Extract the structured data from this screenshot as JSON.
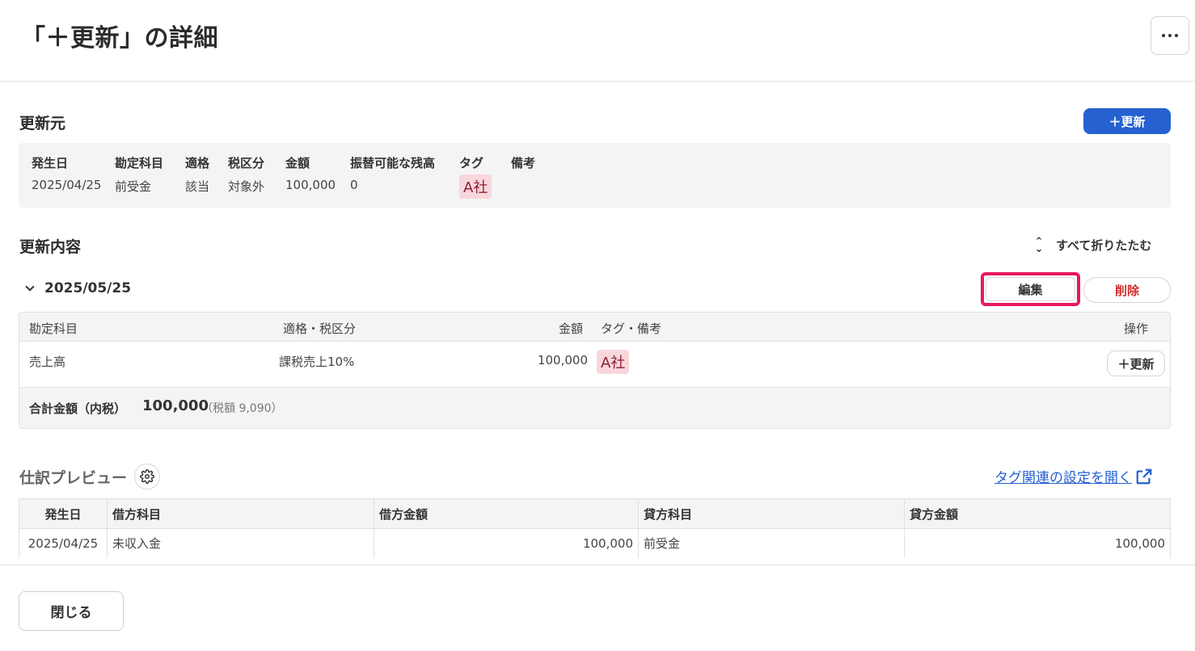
{
  "header": {
    "title": "「＋更新」の詳細",
    "more_icon": "more-horizontal-icon"
  },
  "source": {
    "section_title": "更新元",
    "add_button": "＋更新",
    "columns": [
      "発生日",
      "勘定科目",
      "適格",
      "税区分",
      "金額",
      "振替可能な残高",
      "タグ",
      "備考"
    ],
    "values": {
      "date": "2025/04/25",
      "account": "前受金",
      "qualified": "該当",
      "tax": "対象外",
      "amount": "100,000",
      "balance": "0",
      "tag": "A社",
      "memo": ""
    }
  },
  "update": {
    "section_title": "更新内容",
    "collapse_all": "すべて折りたたむ",
    "group_date": "2025/05/25",
    "edit_button": "編集",
    "delete_button": "削除",
    "table_headers": [
      "勘定科目",
      "適格・税区分",
      "金額",
      "タグ・備考",
      "操作"
    ],
    "row": {
      "account": "売上高",
      "tax": "課税売上10%",
      "amount": "100,000",
      "tag": "A社",
      "action": "＋更新"
    },
    "total_label": "合計金額（内税）",
    "total_amount": "100,000",
    "tax_note": "（税額 9,090）"
  },
  "preview": {
    "title": "仕訳プレビュー",
    "gear_icon": "gear-icon",
    "tag_link": "タグ関連の設定を開く",
    "headers": [
      "発生日",
      "借方科目",
      "借方金額",
      "貸方科目",
      "貸方金額"
    ],
    "rows": [
      {
        "date": "2025/04/25",
        "debit_account": "未収入金",
        "debit_amount": "100,000",
        "credit_account": "前受金",
        "credit_amount": "100,000"
      }
    ]
  },
  "footer": {
    "close_button": "閉じる"
  },
  "colors": {
    "primary": "#2561d1",
    "danger": "#d22d2d",
    "highlight": "#e8185c",
    "tag_bg": "#f8d7dc"
  }
}
